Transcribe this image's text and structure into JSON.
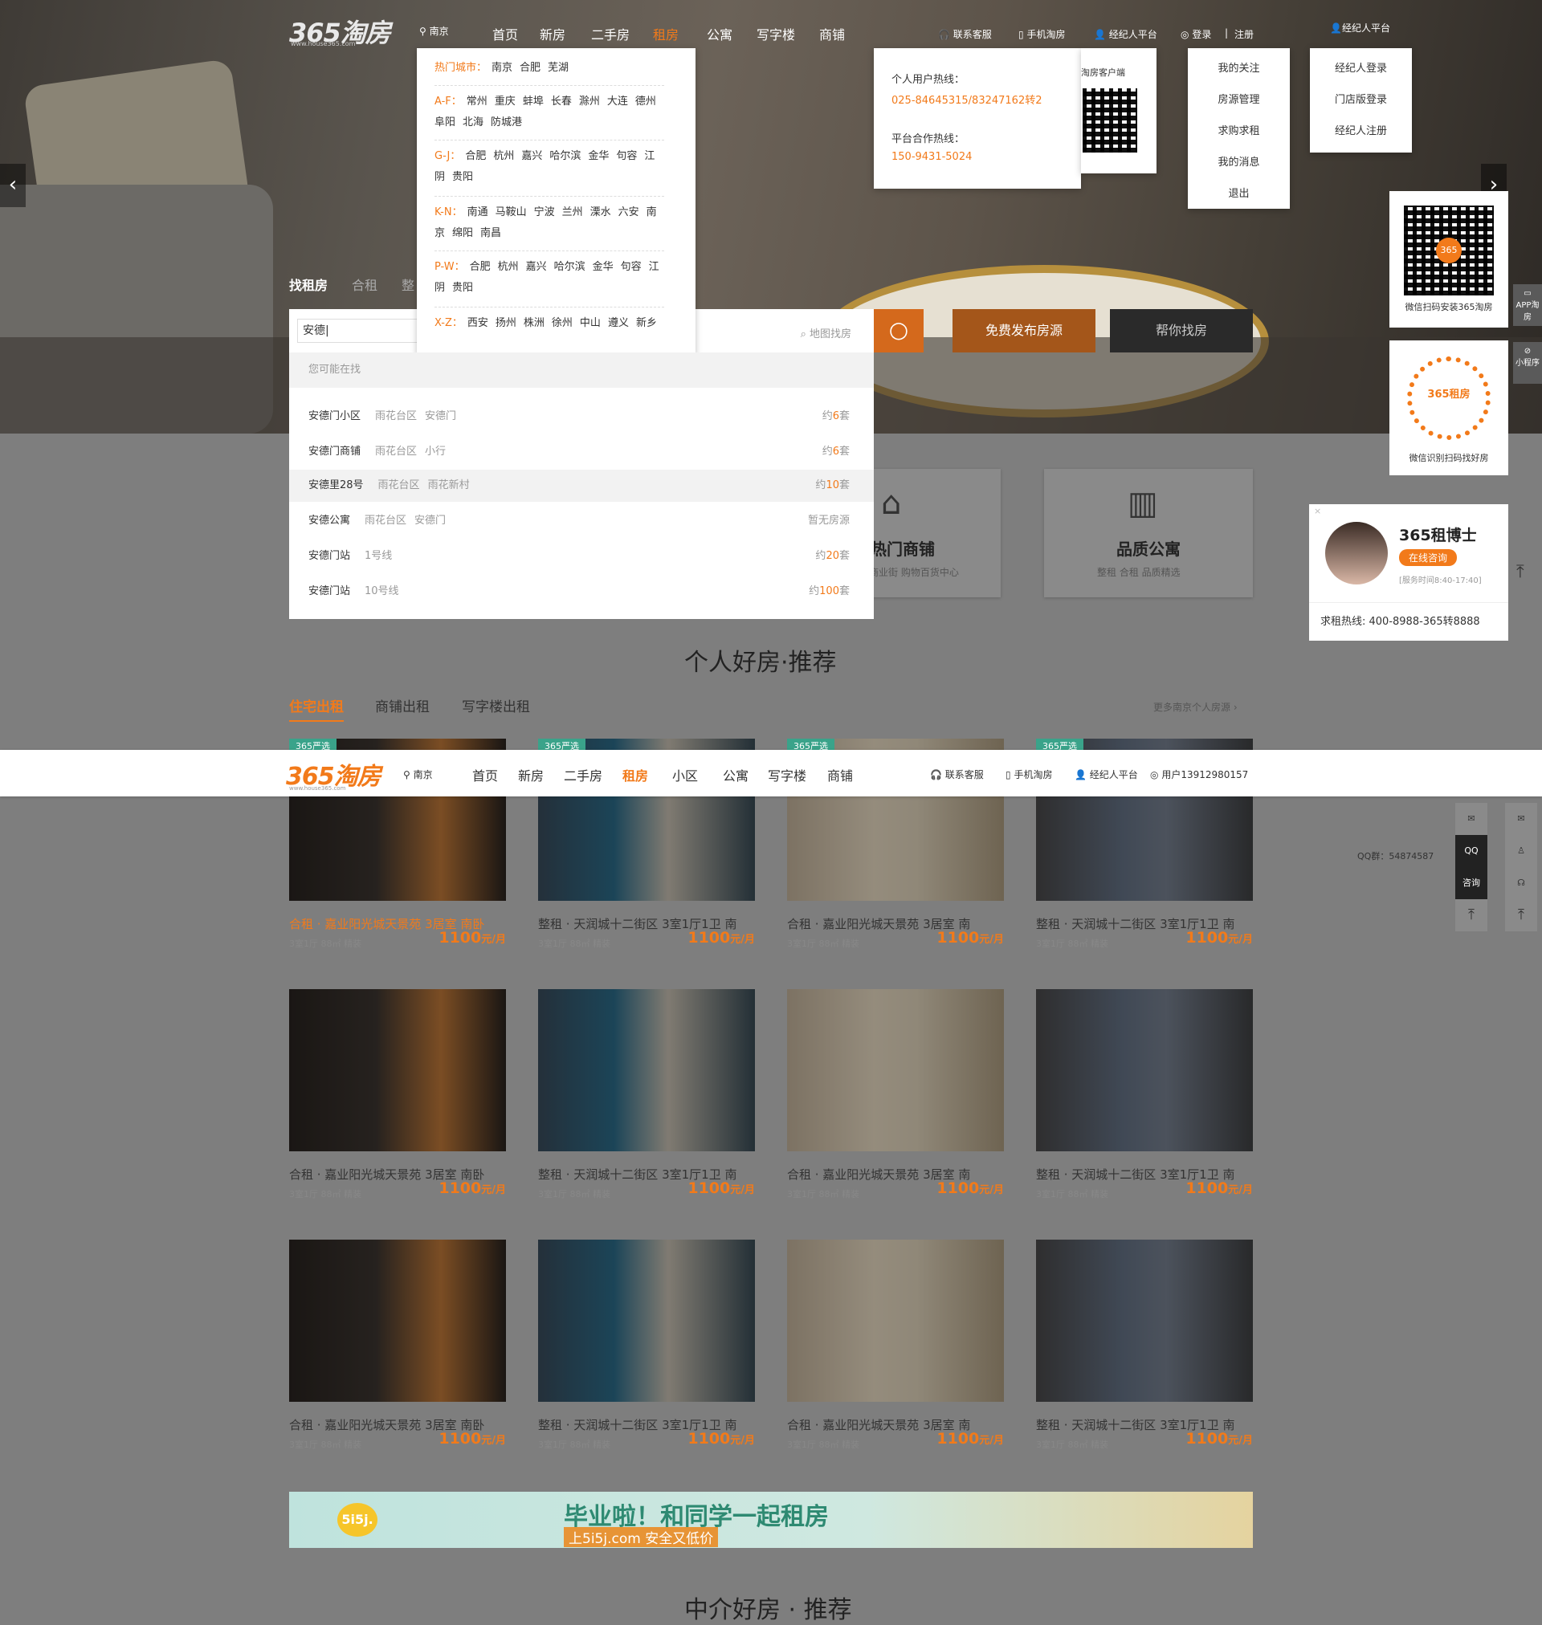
{
  "logo": {
    "text": "365淘房",
    "sub": "www.house365.com"
  },
  "city": "南京",
  "nav": [
    "首页",
    "新房",
    "二手房",
    "租房",
    "公寓",
    "写字楼",
    "商铺"
  ],
  "nav_active": "租房",
  "topbar": {
    "service": "联系客服",
    "mobile": "手机淘房",
    "agent": "经纪人平台",
    "login": "登录",
    "sep": "|",
    "register": "注册",
    "agent_platform": "经纪人平台"
  },
  "city_dropdown": {
    "hot_label": "热门城市：",
    "hot": [
      "南京",
      "合肥",
      "芜湖"
    ],
    "groups": [
      {
        "key": "A-F：",
        "cities": [
          "常州",
          "重庆",
          "蚌埠",
          "长春",
          "滁州",
          "大连",
          "德州",
          "阜阳",
          "北海",
          "防城港"
        ]
      },
      {
        "key": "G-J：",
        "cities": [
          "合肥",
          "杭州",
          "嘉兴",
          "哈尔滨",
          "金华",
          "句容",
          "江阴",
          "贵阳"
        ]
      },
      {
        "key": "K-N：",
        "cities": [
          "南通",
          "马鞍山",
          "宁波",
          "兰州",
          "溧水",
          "六安",
          "南京",
          "绵阳",
          "南昌"
        ]
      },
      {
        "key": "P-W：",
        "cities": [
          "合肥",
          "杭州",
          "嘉兴",
          "哈尔滨",
          "金华",
          "句容",
          "江阴",
          "贵阳"
        ]
      },
      {
        "key": "X-Z：",
        "cities": [
          "西安",
          "扬州",
          "株洲",
          "徐州",
          "中山",
          "遵义",
          "新乡"
        ]
      }
    ]
  },
  "service_dropdown": {
    "user_label": "个人用户热线：",
    "user_phone": "025-84645315/83247162转2",
    "partner_label": "平台合作热线：",
    "partner_phone": "150-9431-5024",
    "app_label": "淘房客户端"
  },
  "user_menu": [
    "我的关注",
    "房源管理",
    "求购求租",
    "我的消息",
    "退出"
  ],
  "agent_menu": [
    "经纪人登录",
    "门店版登录",
    "经纪人注册"
  ],
  "search": {
    "tabs": [
      "找租房",
      "合租",
      "整"
    ],
    "value": "安德|",
    "map": "地图找房",
    "publish": "免费发布房源",
    "help": "帮你找房",
    "maybe": "您可能在找",
    "suggestions": [
      {
        "name": "安德门小区",
        "d1": "雨花台区",
        "d2": "安德门",
        "pre": "约",
        "num": "6",
        "suf": "套"
      },
      {
        "name": "安德门商铺",
        "d1": "雨花台区",
        "d2": "小行",
        "pre": "约",
        "num": "6",
        "suf": "套"
      },
      {
        "name": "安德里28号",
        "d1": "雨花台区",
        "d2": "雨花新村",
        "pre": "约",
        "num": "10",
        "suf": "套"
      },
      {
        "name": "安德公寓",
        "d1": "雨花台区",
        "d2": "安德门",
        "pre": "暂无房源",
        "num": "",
        "suf": ""
      },
      {
        "name": "安德门站",
        "d1": "1号线",
        "d2": "",
        "pre": "约",
        "num": "20",
        "suf": "套"
      },
      {
        "name": "安德门站",
        "d1": "10号线",
        "d2": "",
        "pre": "约",
        "num": "100",
        "suf": "套"
      }
    ]
  },
  "services": [
    {
      "title": "热门商铺",
      "sub": "商业街 购物百货中心"
    },
    {
      "title": "品质公寓",
      "sub": "整租 合租 品质精选"
    }
  ],
  "side": {
    "app_qr": "微信扫码安装365淘房",
    "mini_qr": "微信识别扫码找好房",
    "app_tab": "APP淘房",
    "mini_tab": "小程序",
    "qq_group": "QQ群：54874587",
    "qq": "QQ",
    "consult": "咨询",
    "mini_logo": "365租房",
    "app_logo": "365"
  },
  "advisor": {
    "name": "365租博士",
    "btn": "在线咨询",
    "hours": "[服务时间8:40-17:40]",
    "hotline": "求租热线: 400-8988-365转8888"
  },
  "section": {
    "title_a": "个人好房",
    "title_b": "·推荐",
    "tabs": [
      "住宅出租",
      "商铺出租",
      "写字楼出租"
    ],
    "more": "更多南京个人房源 ›",
    "badge": "365严选"
  },
  "listings": [
    {
      "title": "合租 · 嘉业阳光城天景苑 3居室 南卧",
      "meta": "3室1厅 88㎡ 精装",
      "price": "1100",
      "unit": "元/月"
    },
    {
      "title": "整租 · 天润城十二街区 3室1厅1卫 南",
      "meta": "3室1厅 88㎡ 精装",
      "price": "1100",
      "unit": "元/月"
    },
    {
      "title": "合租 · 嘉业阳光城天景苑 3居室 南",
      "meta": "3室1厅 88㎡ 精装",
      "price": "1100",
      "unit": "元/月"
    },
    {
      "title": "整租 · 天润城十二街区 3室1厅1卫 南",
      "meta": "3室1厅 88㎡ 精装",
      "price": "1100",
      "unit": "元/月"
    }
  ],
  "sticky": {
    "nav": [
      "首页",
      "新房",
      "二手房",
      "租房",
      "小区",
      "公寓",
      "写字楼",
      "商铺"
    ],
    "service": "联系客服",
    "mobile": "手机淘房",
    "agent": "经纪人平台",
    "user": "用户13912980157"
  },
  "banner": {
    "brand": "5i5j.",
    "headline": "毕业啦！和同学一起租房",
    "sub": "上5i5j.com  安全又低价"
  },
  "next_section": "中介好房 · 推荐"
}
